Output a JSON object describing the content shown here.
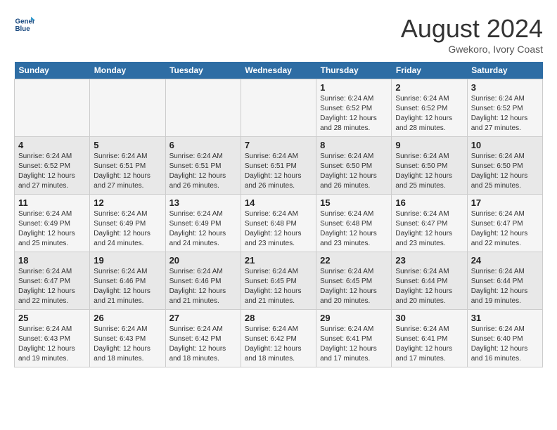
{
  "header": {
    "logo_line1": "General",
    "logo_line2": "Blue",
    "month": "August 2024",
    "location": "Gwekoro, Ivory Coast"
  },
  "weekdays": [
    "Sunday",
    "Monday",
    "Tuesday",
    "Wednesday",
    "Thursday",
    "Friday",
    "Saturday"
  ],
  "weeks": [
    [
      {
        "day": "",
        "info": ""
      },
      {
        "day": "",
        "info": ""
      },
      {
        "day": "",
        "info": ""
      },
      {
        "day": "",
        "info": ""
      },
      {
        "day": "1",
        "info": "Sunrise: 6:24 AM\nSunset: 6:52 PM\nDaylight: 12 hours\nand 28 minutes."
      },
      {
        "day": "2",
        "info": "Sunrise: 6:24 AM\nSunset: 6:52 PM\nDaylight: 12 hours\nand 28 minutes."
      },
      {
        "day": "3",
        "info": "Sunrise: 6:24 AM\nSunset: 6:52 PM\nDaylight: 12 hours\nand 27 minutes."
      }
    ],
    [
      {
        "day": "4",
        "info": "Sunrise: 6:24 AM\nSunset: 6:52 PM\nDaylight: 12 hours\nand 27 minutes."
      },
      {
        "day": "5",
        "info": "Sunrise: 6:24 AM\nSunset: 6:51 PM\nDaylight: 12 hours\nand 27 minutes."
      },
      {
        "day": "6",
        "info": "Sunrise: 6:24 AM\nSunset: 6:51 PM\nDaylight: 12 hours\nand 26 minutes."
      },
      {
        "day": "7",
        "info": "Sunrise: 6:24 AM\nSunset: 6:51 PM\nDaylight: 12 hours\nand 26 minutes."
      },
      {
        "day": "8",
        "info": "Sunrise: 6:24 AM\nSunset: 6:50 PM\nDaylight: 12 hours\nand 26 minutes."
      },
      {
        "day": "9",
        "info": "Sunrise: 6:24 AM\nSunset: 6:50 PM\nDaylight: 12 hours\nand 25 minutes."
      },
      {
        "day": "10",
        "info": "Sunrise: 6:24 AM\nSunset: 6:50 PM\nDaylight: 12 hours\nand 25 minutes."
      }
    ],
    [
      {
        "day": "11",
        "info": "Sunrise: 6:24 AM\nSunset: 6:49 PM\nDaylight: 12 hours\nand 25 minutes."
      },
      {
        "day": "12",
        "info": "Sunrise: 6:24 AM\nSunset: 6:49 PM\nDaylight: 12 hours\nand 24 minutes."
      },
      {
        "day": "13",
        "info": "Sunrise: 6:24 AM\nSunset: 6:49 PM\nDaylight: 12 hours\nand 24 minutes."
      },
      {
        "day": "14",
        "info": "Sunrise: 6:24 AM\nSunset: 6:48 PM\nDaylight: 12 hours\nand 23 minutes."
      },
      {
        "day": "15",
        "info": "Sunrise: 6:24 AM\nSunset: 6:48 PM\nDaylight: 12 hours\nand 23 minutes."
      },
      {
        "day": "16",
        "info": "Sunrise: 6:24 AM\nSunset: 6:47 PM\nDaylight: 12 hours\nand 23 minutes."
      },
      {
        "day": "17",
        "info": "Sunrise: 6:24 AM\nSunset: 6:47 PM\nDaylight: 12 hours\nand 22 minutes."
      }
    ],
    [
      {
        "day": "18",
        "info": "Sunrise: 6:24 AM\nSunset: 6:47 PM\nDaylight: 12 hours\nand 22 minutes."
      },
      {
        "day": "19",
        "info": "Sunrise: 6:24 AM\nSunset: 6:46 PM\nDaylight: 12 hours\nand 21 minutes."
      },
      {
        "day": "20",
        "info": "Sunrise: 6:24 AM\nSunset: 6:46 PM\nDaylight: 12 hours\nand 21 minutes."
      },
      {
        "day": "21",
        "info": "Sunrise: 6:24 AM\nSunset: 6:45 PM\nDaylight: 12 hours\nand 21 minutes."
      },
      {
        "day": "22",
        "info": "Sunrise: 6:24 AM\nSunset: 6:45 PM\nDaylight: 12 hours\nand 20 minutes."
      },
      {
        "day": "23",
        "info": "Sunrise: 6:24 AM\nSunset: 6:44 PM\nDaylight: 12 hours\nand 20 minutes."
      },
      {
        "day": "24",
        "info": "Sunrise: 6:24 AM\nSunset: 6:44 PM\nDaylight: 12 hours\nand 19 minutes."
      }
    ],
    [
      {
        "day": "25",
        "info": "Sunrise: 6:24 AM\nSunset: 6:43 PM\nDaylight: 12 hours\nand 19 minutes."
      },
      {
        "day": "26",
        "info": "Sunrise: 6:24 AM\nSunset: 6:43 PM\nDaylight: 12 hours\nand 18 minutes."
      },
      {
        "day": "27",
        "info": "Sunrise: 6:24 AM\nSunset: 6:42 PM\nDaylight: 12 hours\nand 18 minutes."
      },
      {
        "day": "28",
        "info": "Sunrise: 6:24 AM\nSunset: 6:42 PM\nDaylight: 12 hours\nand 18 minutes."
      },
      {
        "day": "29",
        "info": "Sunrise: 6:24 AM\nSunset: 6:41 PM\nDaylight: 12 hours\nand 17 minutes."
      },
      {
        "day": "30",
        "info": "Sunrise: 6:24 AM\nSunset: 6:41 PM\nDaylight: 12 hours\nand 17 minutes."
      },
      {
        "day": "31",
        "info": "Sunrise: 6:24 AM\nSunset: 6:40 PM\nDaylight: 12 hours\nand 16 minutes."
      }
    ]
  ]
}
